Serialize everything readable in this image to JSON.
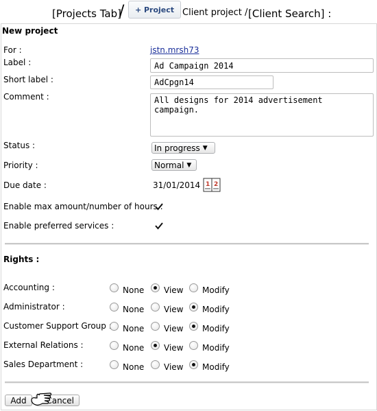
{
  "breadcrumb": {
    "projects_tab": "[Projects Tab]",
    "separator": "/",
    "project_button": "+ Project",
    "client_project": "Client project /",
    "client_search": "[Client Search] :"
  },
  "form": {
    "title": "New project",
    "for_label": "For :",
    "for_value": "jstn.mrsh73",
    "label_label": "Label :",
    "label_value": "Ad Campaign 2014",
    "short_label_label": "Short label :",
    "short_label_value": "AdCpgn14",
    "comment_label": "Comment :",
    "comment_value": "All designs for 2014 advertisement campaign.",
    "status_label": "Status :",
    "status_value": "In progress",
    "priority_label": "Priority :",
    "priority_value": "Normal",
    "due_date_label": "Due date :",
    "due_date_value": "31/01/2014",
    "enable_max_label": "Enable max amount/number of hours :",
    "enable_max_checked": true,
    "enable_preferred_label": "Enable preferred services :",
    "enable_preferred_checked": true
  },
  "rights": {
    "title": "Rights :",
    "options": [
      "None",
      "View",
      "Modify"
    ],
    "groups": [
      {
        "name": "Accounting :",
        "selected": "View"
      },
      {
        "name": "Administrator :",
        "selected": "Modify"
      },
      {
        "name": "Customer Support Group :",
        "selected": "Modify"
      },
      {
        "name": "External Relations :",
        "selected": "View"
      },
      {
        "name": "Sales Department :",
        "selected": "Modify"
      }
    ]
  },
  "actions": {
    "add_label": "Add",
    "cancel_label": "Cancel"
  },
  "icons": {
    "calendar": "calendar-icon",
    "cursor": "hand-cursor-icon",
    "check": "checkmark-icon"
  }
}
